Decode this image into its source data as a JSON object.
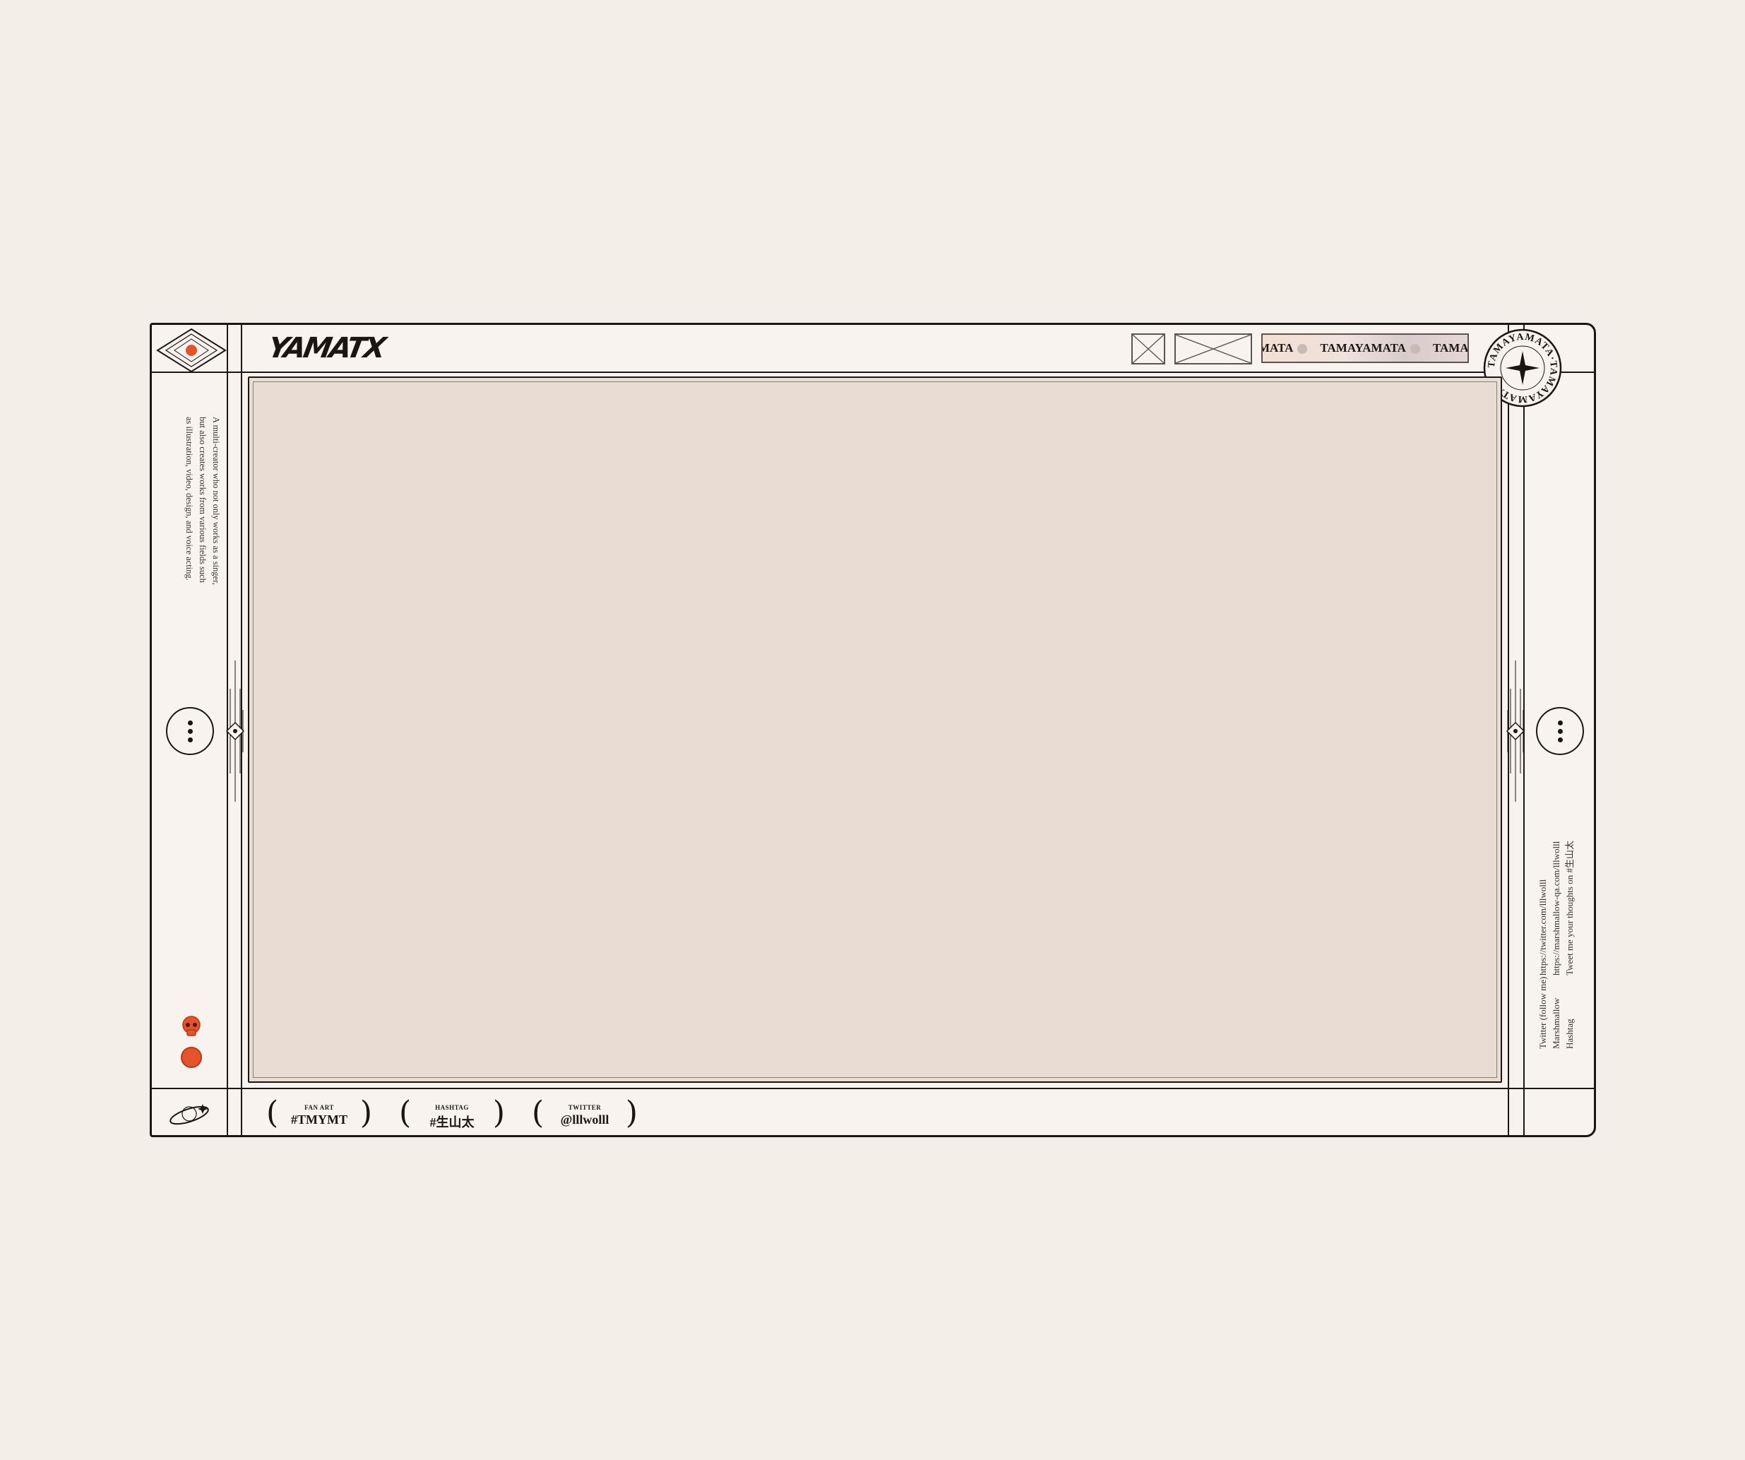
{
  "brand": {
    "logo_text": "YAMATX"
  },
  "ticker": {
    "items": [
      "MATA",
      "TAMAYAMATA",
      "TAMAYA"
    ]
  },
  "seal": {
    "ring_text": "TAMAYAMATA·TAMAYAMATA·"
  },
  "sidebar": {
    "description_lines": [
      "A multi-creator who not only works as a singer,",
      "but also creates works from various fields such",
      "as illustration, video, design, and voice acting."
    ]
  },
  "info": {
    "rows": [
      {
        "key": "Twitter (follow me)",
        "value": "https://twitter.com/lllwolll"
      },
      {
        "key": "Marshmallow",
        "value": "https://marshmallow-qa.com/lllwolll"
      },
      {
        "key": "Hashtag",
        "value": "Tweet me your thoughts on #生山太"
      }
    ]
  },
  "footer": {
    "badges": [
      {
        "caption": "FAN ART",
        "value": "#TMYMT"
      },
      {
        "caption": "HASHTAG",
        "value": "#生山太"
      },
      {
        "caption": "TWITTER",
        "value": "@lllwolll"
      }
    ]
  },
  "colors": {
    "accent": "#e5532b",
    "ink": "#1b1613",
    "viewport": "#e9ddd3",
    "page": "#f3eee8"
  }
}
